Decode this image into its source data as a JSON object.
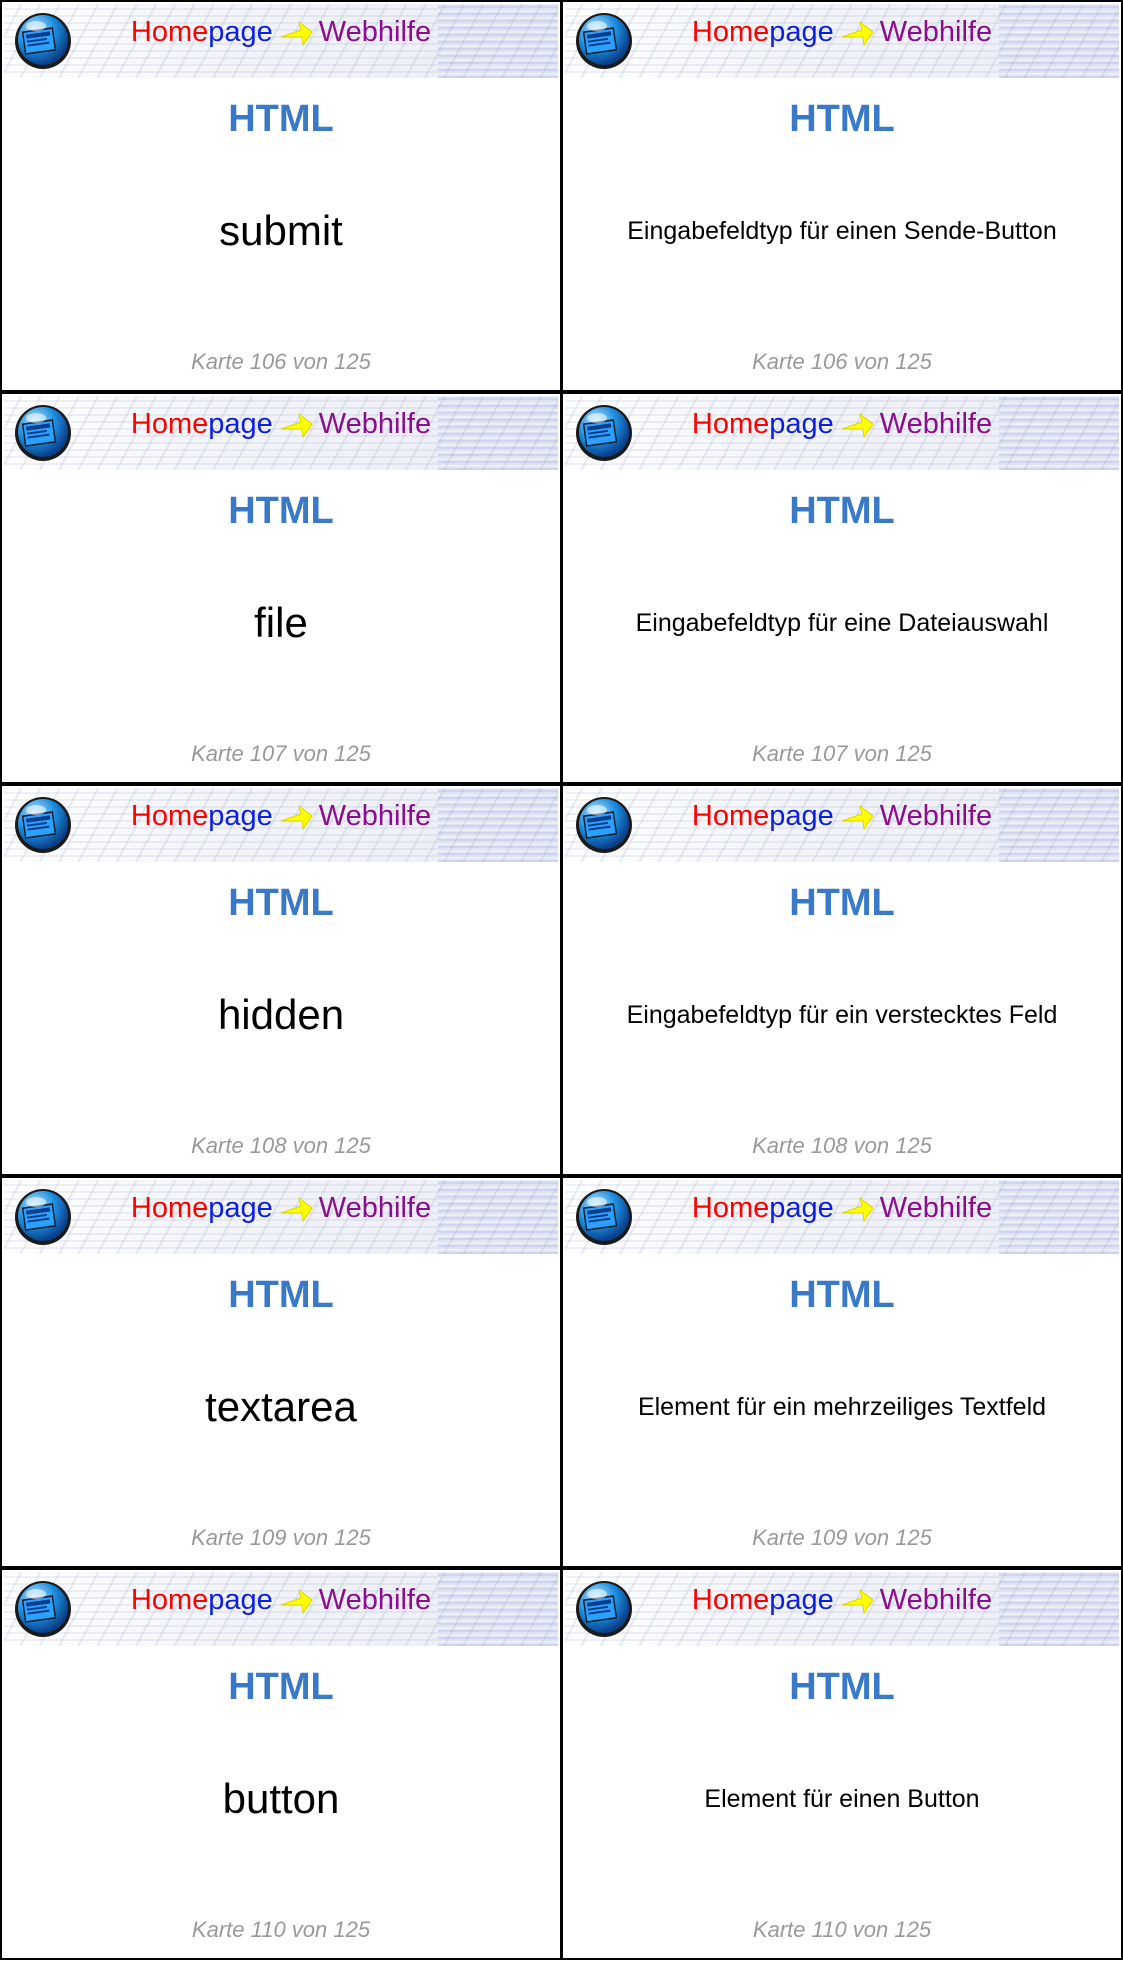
{
  "banner": {
    "brand_part1": "Home",
    "brand_part2": "page",
    "brand_part3": "Webhilfe",
    "colors": {
      "home": "#ff0000",
      "page": "#0b1fe0",
      "web": "#8b0d8b",
      "arrow": "#ffff00",
      "title": "#3a78c8",
      "counter": "#999999"
    }
  },
  "cards": [
    {
      "title": "HTML",
      "front": "submit",
      "back": "Eingabefeldtyp für einen Sende-Button",
      "counter": "Karte 106 von 125"
    },
    {
      "title": "HTML",
      "front": "file",
      "back": "Eingabefeldtyp für eine Dateiauswahl",
      "counter": "Karte 107 von 125"
    },
    {
      "title": "HTML",
      "front": "hidden",
      "back": "Eingabefeldtyp für ein verstecktes Feld",
      "counter": "Karte 108 von 125"
    },
    {
      "title": "HTML",
      "front": "textarea",
      "back": "Element für ein mehrzeiliges Textfeld",
      "counter": "Karte 109 von 125"
    },
    {
      "title": "HTML",
      "front": "button",
      "back": "Element für einen Button",
      "counter": "Karte 110 von 125"
    }
  ]
}
